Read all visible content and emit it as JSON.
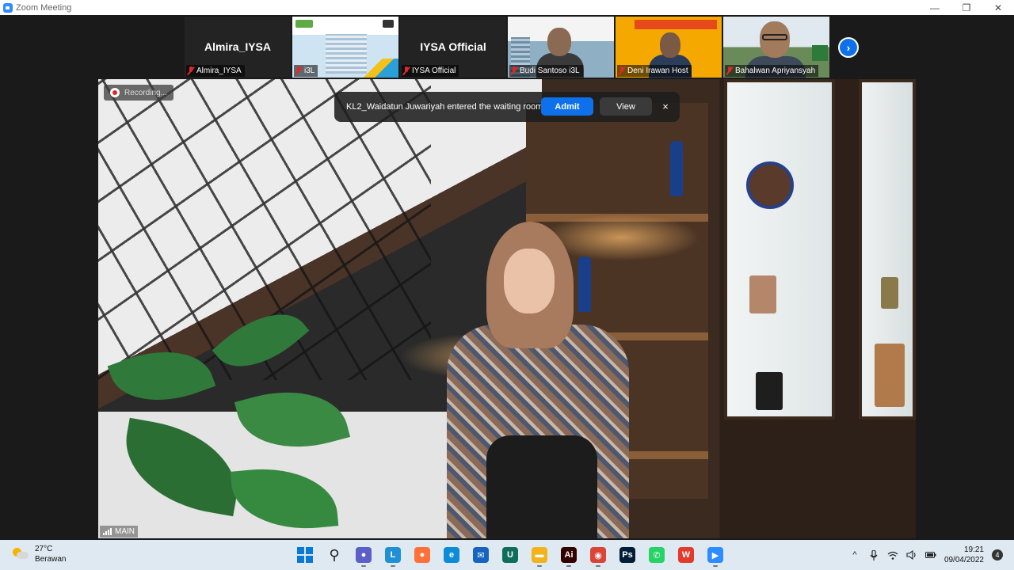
{
  "window": {
    "title": "Zoom Meeting",
    "controls": [
      "—",
      "❐",
      "✕"
    ]
  },
  "participants": [
    {
      "display": "Almira_IYSA",
      "label": "Almira_IYSA",
      "muted": true,
      "video": false
    },
    {
      "display": "",
      "label": "i3L",
      "muted": true,
      "video": true
    },
    {
      "display": "IYSA Official",
      "label": "IYSA Official",
      "muted": true,
      "video": false
    },
    {
      "display": "",
      "label": "Budi Santoso i3L",
      "muted": true,
      "video": true
    },
    {
      "display": "",
      "label": "Deni Irawan Host",
      "muted": true,
      "video": true
    },
    {
      "display": "",
      "label": "Bahalwan Apriyansyah",
      "muted": true,
      "video": true
    }
  ],
  "next_page_icon": "chevron-right-icon",
  "recording": {
    "label": "Recording..."
  },
  "waiting_room": {
    "message": "KL2_Waidatun Juwariyah entered the waiting room",
    "admit_label": "Admit",
    "view_label": "View",
    "close_label": "×"
  },
  "main_video": {
    "label": "MAIN"
  },
  "taskbar": {
    "weather": {
      "temp": "27°C",
      "condition": "Berawan"
    },
    "apps": [
      {
        "name": "windows-start-icon",
        "glyph": "",
        "color": "#0a78d7"
      },
      {
        "name": "search-icon",
        "glyph": "⚲",
        "color": "#222222"
      },
      {
        "name": "chat-icon",
        "glyph": "●",
        "color": "#5b5fc7"
      },
      {
        "name": "lumos-icon",
        "glyph": "L",
        "color": "#1f8fd6"
      },
      {
        "name": "firefox-icon",
        "glyph": "●",
        "color": "#ff7139"
      },
      {
        "name": "edge-icon",
        "glyph": "e",
        "color": "#0c8bd6"
      },
      {
        "name": "mail-icon",
        "glyph": "✉",
        "color": "#1565c0"
      },
      {
        "name": "upwork-icon",
        "glyph": "U",
        "color": "#0e6e5a"
      },
      {
        "name": "file-explorer-icon",
        "glyph": "▬",
        "color": "#f2b41a"
      },
      {
        "name": "illustrator-icon",
        "glyph": "Ai",
        "color": "#330000"
      },
      {
        "name": "chrome-icon",
        "glyph": "◉",
        "color": "#db4437"
      },
      {
        "name": "photoshop-icon",
        "glyph": "Ps",
        "color": "#001e36"
      },
      {
        "name": "whatsapp-icon",
        "glyph": "✆",
        "color": "#25d366"
      },
      {
        "name": "wps-icon",
        "glyph": "W",
        "color": "#e23b2e"
      },
      {
        "name": "zoom-icon",
        "glyph": "▶",
        "color": "#2d8cff"
      }
    ],
    "tray": {
      "chevron": "^",
      "clock_time": "19:21",
      "clock_date": "09/04/2022",
      "notifications": "4"
    }
  }
}
